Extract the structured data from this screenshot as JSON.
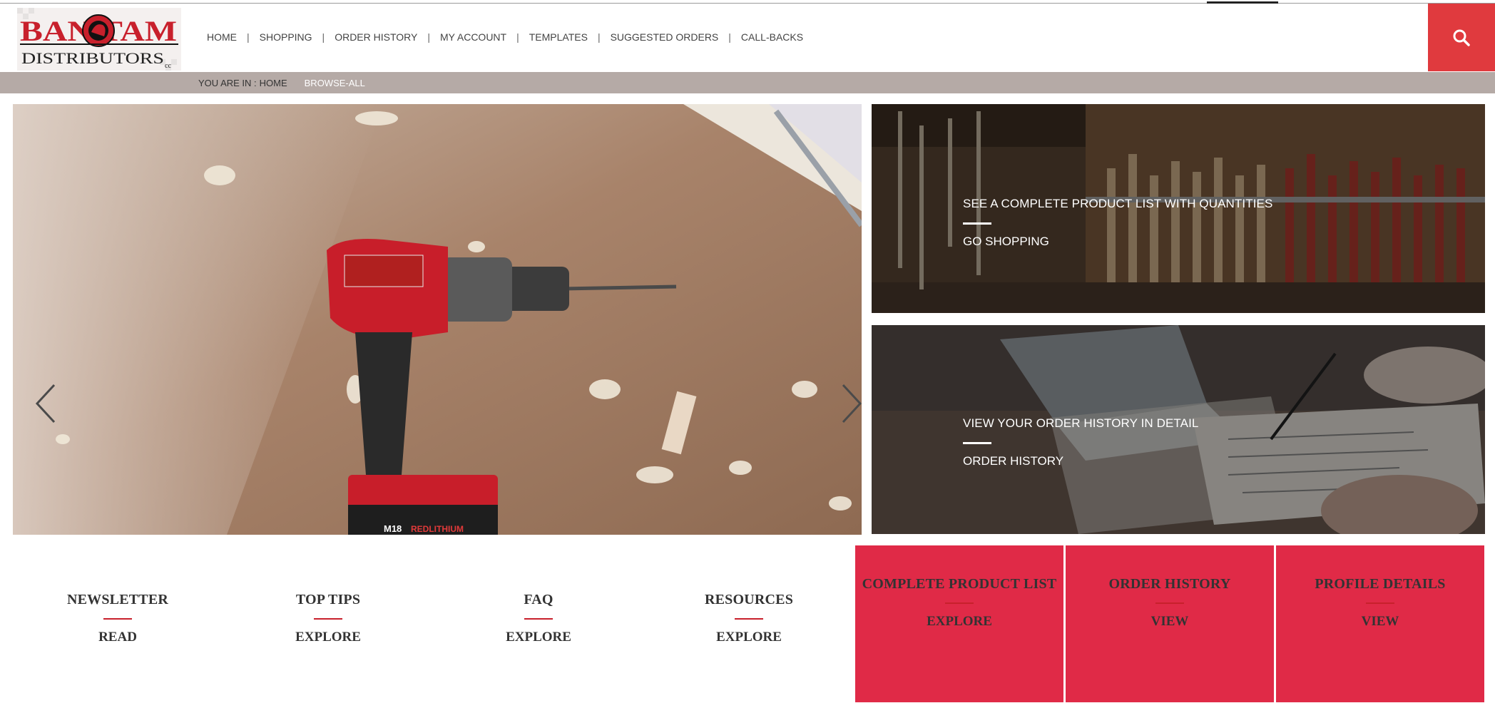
{
  "brand": {
    "logo_top": "BANTAM",
    "logo_bottom": "DISTRIBUTORS",
    "logo_suffix": "cc"
  },
  "nav": {
    "items": [
      "HOME",
      "SHOPPING",
      "ORDER HISTORY",
      "MY ACCOUNT",
      "TEMPLATES",
      "SUGGESTED ORDERS",
      "CALL-BACKS"
    ],
    "separator": "|"
  },
  "breadcrumb": {
    "prefix": "YOU ARE IN :",
    "home": "HOME",
    "current": "BROWSE-ALL"
  },
  "promos": [
    {
      "title": "SEE A COMPLETE PRODUCT LIST WITH QUANTITIES",
      "link": "GO SHOPPING"
    },
    {
      "title": "VIEW YOUR ORDER HISTORY IN DETAIL",
      "link": "ORDER HISTORY"
    }
  ],
  "tiles": [
    {
      "title": "NEWSLETTER",
      "link": "READ"
    },
    {
      "title": "TOP TIPS",
      "link": "EXPLORE"
    },
    {
      "title": "FAQ",
      "link": "EXPLORE"
    },
    {
      "title": "RESOURCES",
      "link": "EXPLORE"
    }
  ],
  "red_tiles": [
    {
      "title": "COMPLETE PRODUCT LIST",
      "link": "EXPLORE"
    },
    {
      "title": "ORDER HISTORY",
      "link": "VIEW"
    },
    {
      "title": "PROFILE DETAILS",
      "link": "VIEW"
    }
  ],
  "hero": {
    "drill_brand": "M18",
    "drill_battery": "REDLITHIUM"
  },
  "colors": {
    "accent": "#e03a3e",
    "tile_red": "#e02a47",
    "breadcrumb_bg": "#b5aaa6"
  }
}
